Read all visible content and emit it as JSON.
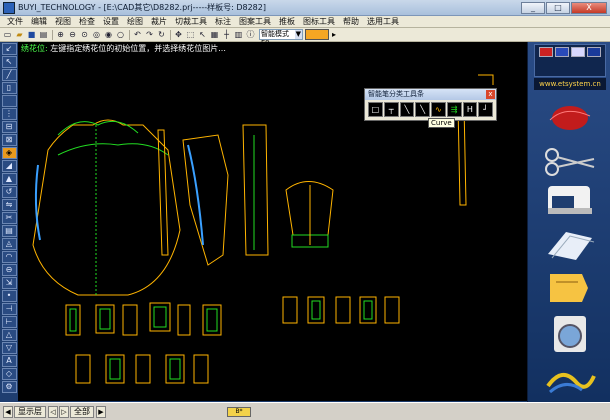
{
  "window": {
    "title": "BUYI_TECHNOLOGY - [E:\\CAD其它\\D8282.prj-----样板号: D8282]",
    "minimize": "_",
    "maximize": "□",
    "close": "X"
  },
  "menu": [
    "文件",
    "编辑",
    "视图",
    "检查",
    "设置",
    "绘图",
    "裁片",
    "切裁工具",
    "标注",
    "图案工具",
    "推板",
    "图标工具",
    "帮助",
    "选用工具"
  ],
  "toolbar": {
    "mode_select": "智能模式F8",
    "mode_arrow": "▼",
    "color_accent": "#f5a623"
  },
  "hint": {
    "label": "绣花位:",
    "text": " 左键指定绣花位的初始位置，并选择绣花位图片..."
  },
  "palette": {
    "title": "智能笔分类工具条",
    "close": "x",
    "tooltip": "Curve"
  },
  "rightpanel": {
    "site": "www.etsystem.cn",
    "items": [
      "sewing-thread-icon",
      "scissors-icon",
      "sewing-machine-icon",
      "fabric-icon",
      "pattern-icon",
      "washing-machine-icon",
      "logo-icon"
    ]
  },
  "status": {
    "layer_label": "显示层",
    "all_label": "全部",
    "nav_first": "◀",
    "nav_prev": "◁",
    "nav_next": "▷",
    "nav_last": "▶",
    "swatch_label": "B*"
  },
  "colors": {
    "canvas_bg": "#000000",
    "piece_line": "#ffb400",
    "piece_green": "#22dd22",
    "piece_blue": "#3aa0ff"
  }
}
